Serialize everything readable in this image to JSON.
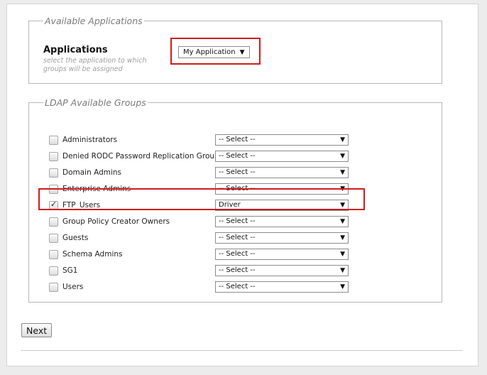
{
  "applications": {
    "legend": "Available Applications",
    "title": "Applications",
    "description": "select the application to which groups will be assigned",
    "selected": "My Application",
    "arrow": "▼"
  },
  "groups": {
    "legend": "LDAP Available Groups",
    "items": [
      {
        "label": "Administrators",
        "checked": false,
        "role": "-- Select --"
      },
      {
        "label": "Denied RODC Password Replication Group",
        "checked": false,
        "role": "-- Select --"
      },
      {
        "label": "Domain Admins",
        "checked": false,
        "role": "-- Select --"
      },
      {
        "label": "Enterprise Admins",
        "checked": false,
        "role": "-- Select --"
      },
      {
        "label": "FTP_Users",
        "checked": true,
        "role": "Driver"
      },
      {
        "label": "Group Policy Creator Owners",
        "checked": false,
        "role": "-- Select --"
      },
      {
        "label": "Guests",
        "checked": false,
        "role": "-- Select --"
      },
      {
        "label": "Schema Admins",
        "checked": false,
        "role": "-- Select --"
      },
      {
        "label": "SG1",
        "checked": false,
        "role": "-- Select --"
      },
      {
        "label": "Users",
        "checked": false,
        "role": "-- Select --"
      }
    ]
  },
  "actions": {
    "next_label": "Next"
  },
  "colors": {
    "highlight": "#d01c1c",
    "background": "#ececec",
    "panel": "#ffffff"
  }
}
